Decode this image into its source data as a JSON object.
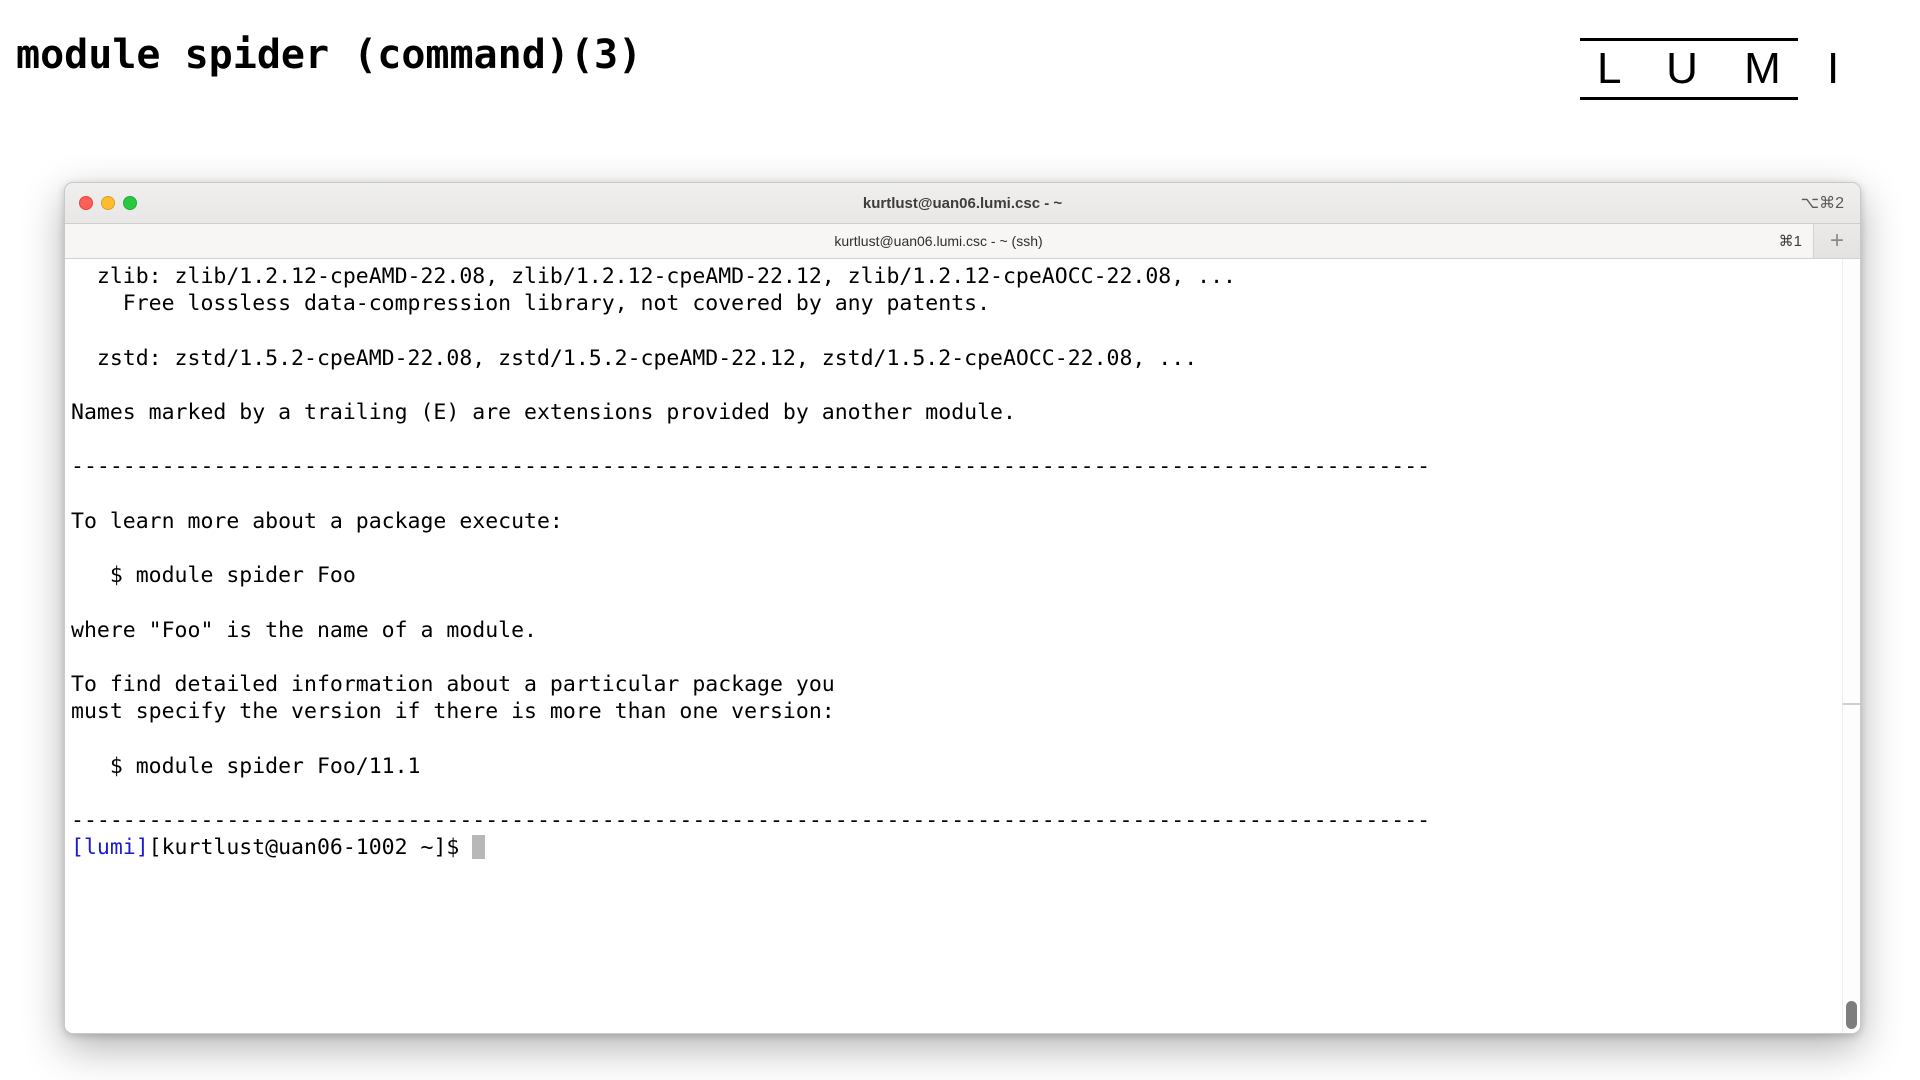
{
  "slide": {
    "title": "module spider (command)(3)",
    "logo": {
      "wordmark": "L U M I",
      "name": "lumi-logo"
    }
  },
  "terminal": {
    "window_title": "kurtlust@uan06.lumi.csc - ~",
    "title_shortcut": "⌥⌘2",
    "tab_label": "kurtlust@uan06.lumi.csc - ~ (ssh)",
    "tab_shortcut": "⌘1",
    "new_tab_label": "+",
    "traffic_lights": {
      "close": "close-button",
      "minimize": "minimize-button",
      "maximize": "maximize-button"
    },
    "colors": {
      "prompt_blue": "#1a1ad0",
      "cursor_gray": "#b8b8b8",
      "text_black": "#000000",
      "background": "#ffffff"
    },
    "lines": [
      "  zlib: zlib/1.2.12-cpeAMD-22.08, zlib/1.2.12-cpeAMD-22.12, zlib/1.2.12-cpeAOCC-22.08, ...",
      "    Free lossless data-compression library, not covered by any patents.",
      "",
      "  zstd: zstd/1.5.2-cpeAMD-22.08, zstd/1.5.2-cpeAMD-22.12, zstd/1.5.2-cpeAOCC-22.08, ...",
      "",
      "Names marked by a trailing (E) are extensions provided by another module.",
      "",
      "---------------------------------------------------------------------------------------------------------",
      "",
      "To learn more about a package execute:",
      "",
      "   $ module spider Foo",
      "",
      "where \"Foo\" is the name of a module.",
      "",
      "To find detailed information about a particular package you",
      "must specify the version if there is more than one version:",
      "",
      "   $ module spider Foo/11.1",
      "",
      "---------------------------------------------------------------------------------------------------------"
    ],
    "prompt": {
      "host_tag": "[lumi]",
      "user_host_path": "[kurtlust@uan06-1002 ~]$ "
    }
  }
}
